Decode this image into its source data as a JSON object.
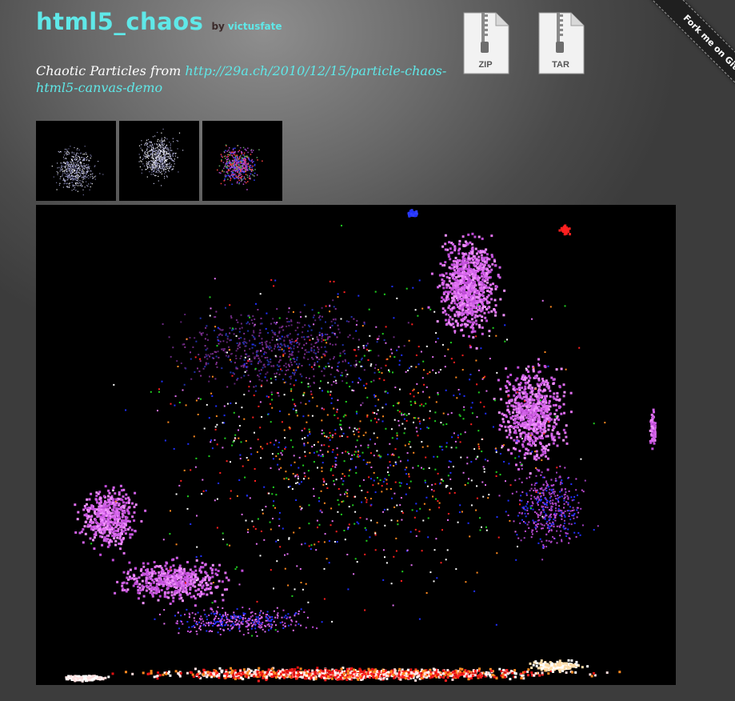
{
  "header": {
    "repo_name": "html5_chaos",
    "by_label": "by",
    "author": "victusfate"
  },
  "description": {
    "text": "Chaotic Particles from ",
    "link": "http://29a.ch/2010/12/15/particle-chaos-html5-canvas-demo"
  },
  "downloads": [
    {
      "label": "ZIP",
      "icon": "zip-file-icon"
    },
    {
      "label": "TAR",
      "icon": "tar-file-icon"
    }
  ],
  "ribbon": {
    "label": "Fork me on GitHub"
  },
  "thumbnails": [
    {
      "name": "thumbnail-1"
    },
    {
      "name": "thumbnail-2"
    },
    {
      "name": "thumbnail-3"
    }
  ],
  "colors": {
    "accent": "#5fe8e8",
    "canvas_bg": "#000000",
    "particles": [
      "#e070f0",
      "#c04cd8",
      "#ff2020",
      "#20d020",
      "#2030ff",
      "#ff8a20",
      "#ffffff"
    ]
  }
}
